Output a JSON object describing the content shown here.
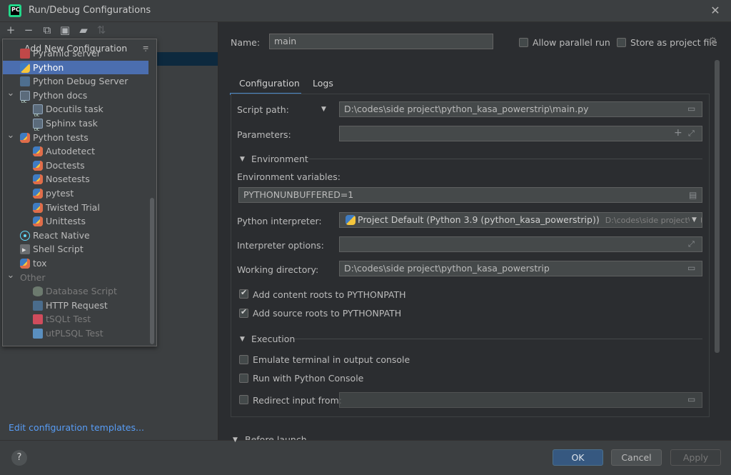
{
  "window": {
    "title": "Run/Debug Configurations",
    "app_icon": "pycharm-icon"
  },
  "toolbar": {
    "items": [
      "add-icon",
      "remove-icon",
      "copy-icon",
      "save-icon",
      "folder-add-icon",
      "sort-icon"
    ]
  },
  "popup": {
    "title": "Add New Configuration",
    "items": [
      {
        "label": "Pyramid server",
        "icon": "pyramid-icon",
        "level": 1
      },
      {
        "label": "Python",
        "icon": "python-icon",
        "level": 1,
        "selected": true
      },
      {
        "label": "Python Debug Server",
        "icon": "debug-server-icon",
        "level": 1
      },
      {
        "label": "Python docs",
        "icon": "docs-icon",
        "level": 1,
        "expandable": true
      },
      {
        "label": "Docutils task",
        "icon": "docs-icon",
        "level": 2
      },
      {
        "label": "Sphinx task",
        "icon": "docs-icon",
        "level": 2
      },
      {
        "label": "Python tests",
        "icon": "python-tests-icon",
        "level": 1,
        "expandable": true
      },
      {
        "label": "Autodetect",
        "icon": "python-tests-icon",
        "level": 2
      },
      {
        "label": "Doctests",
        "icon": "python-tests-icon",
        "level": 2
      },
      {
        "label": "Nosetests",
        "icon": "python-tests-icon",
        "level": 2
      },
      {
        "label": "pytest",
        "icon": "python-tests-icon",
        "level": 2
      },
      {
        "label": "Twisted Trial",
        "icon": "python-tests-icon",
        "level": 2
      },
      {
        "label": "Unittests",
        "icon": "python-tests-icon",
        "level": 2
      },
      {
        "label": "React Native",
        "icon": "react-icon",
        "level": 1
      },
      {
        "label": "Shell Script",
        "icon": "shell-icon",
        "level": 1
      },
      {
        "label": "tox",
        "icon": "python-tests-icon",
        "level": 1
      },
      {
        "label": "Other",
        "icon": "",
        "level": 0,
        "expandable": true,
        "disabled": true
      },
      {
        "label": "Database Script",
        "icon": "database-icon",
        "level": 2,
        "disabled": true
      },
      {
        "label": "HTTP Request",
        "icon": "http-icon",
        "level": 2
      },
      {
        "label": "tSQLt Test",
        "icon": "tsqlt-icon",
        "level": 2,
        "disabled": true
      },
      {
        "label": "utPLSQL Test",
        "icon": "utplsql-icon",
        "level": 2,
        "disabled": true
      }
    ]
  },
  "left": {
    "edit_templates": "Edit configuration templates..."
  },
  "header": {
    "name_label": "Name:",
    "name_value": "main",
    "allow_parallel": "Allow parallel run",
    "store_project": "Store as project file"
  },
  "tabs": [
    {
      "label": "Configuration",
      "active": true
    },
    {
      "label": "Logs",
      "active": false
    }
  ],
  "config": {
    "script_path_label": "Script path:",
    "script_path_value": "D:\\codes\\side project\\python_kasa_powerstrip\\main.py",
    "parameters_label": "Parameters:",
    "parameters_value": "",
    "environment_section": "Environment",
    "env_vars_label": "Environment variables:",
    "env_vars_value": "PYTHONUNBUFFERED=1",
    "interpreter_label": "Python interpreter:",
    "interpreter_value": "Project Default (Python 3.9 (python_kasa_powerstrip))",
    "interpreter_path": "D:\\codes\\side project\\python_ka",
    "interp_options_label": "Interpreter options:",
    "interp_options_value": "",
    "workdir_label": "Working directory:",
    "workdir_value": "D:\\codes\\side project\\python_kasa_powerstrip",
    "add_content_roots": "Add content roots to PYTHONPATH",
    "add_source_roots": "Add source roots to PYTHONPATH",
    "execution_section": "Execution",
    "emulate_terminal": "Emulate terminal in output console",
    "run_with_console": "Run with Python Console",
    "redirect_input": "Redirect input from:",
    "redirect_value": "",
    "before_launch": "Before launch"
  },
  "buttons": {
    "ok": "OK",
    "cancel": "Cancel",
    "apply": "Apply",
    "help": "?"
  }
}
